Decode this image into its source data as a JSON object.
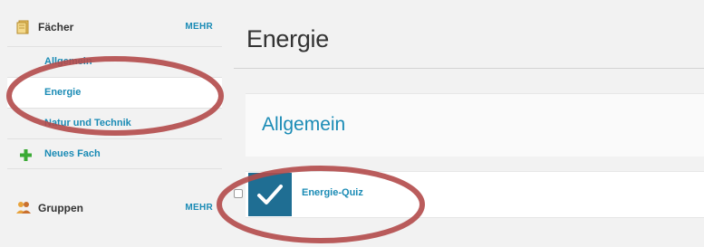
{
  "sidebar": {
    "subjects": {
      "title": "Fächer",
      "more": "MEHR",
      "icon": "book-icon",
      "items": [
        {
          "label": "Allgemein"
        },
        {
          "label": "Energie",
          "active": true
        },
        {
          "label": "Natur und Technik"
        }
      ],
      "new_item": {
        "label": "Neues Fach",
        "icon": "plus-icon"
      }
    },
    "groups": {
      "title": "Gruppen",
      "more": "MEHR",
      "icon": "group-icon"
    }
  },
  "main": {
    "title": "Energie",
    "section": {
      "title": "Allgemein",
      "items": [
        {
          "label": "Energie-Quiz",
          "icon": "checkmark-icon",
          "checked": false
        }
      ]
    }
  },
  "colors": {
    "link": "#1a8bb5",
    "tile": "#1f6e93",
    "annotation": "#b24a4a",
    "add": "#3aaa35"
  }
}
